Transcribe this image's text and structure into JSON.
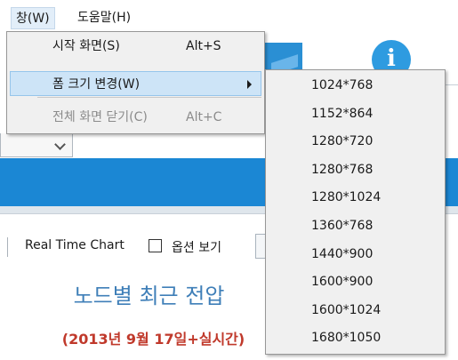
{
  "menubar": {
    "items": [
      {
        "label": "창(W)",
        "active": true
      },
      {
        "label": "도움말(H)",
        "active": false
      }
    ]
  },
  "window_menu": {
    "items": [
      {
        "label": "시작 화면(S)",
        "shortcut": "Alt+S",
        "enabled": true
      },
      {
        "label": "폼 크기 변경(W)",
        "shortcut": "",
        "enabled": true,
        "has_submenu": true
      },
      {
        "label": "전체 화면 닫기(C)",
        "shortcut": "Alt+C",
        "enabled": false
      }
    ]
  },
  "resize_submenu": {
    "items": [
      "1024*768",
      "1152*864",
      "1280*720",
      "1280*768",
      "1280*1024",
      "1360*768",
      "1440*900",
      "1600*900",
      "1600*1024",
      "1680*1050"
    ]
  },
  "toolbar": {
    "chart_label": "Real Time Chart",
    "options_label": "옵션 보기",
    "options_checked": false
  },
  "page": {
    "title": "노드별 최근 전압",
    "subtitle": "(2013년 9월 17일+실시간)"
  },
  "colors": {
    "accent_blue": "#1b87d4",
    "title_blue": "#3f7fb8",
    "subtitle_red": "#c0392b",
    "menu_highlight": "#cde4f7"
  },
  "icons": {
    "info": "info-icon",
    "dropdown": "chevron-down-icon",
    "submenu_arrow": "chevron-right-icon"
  }
}
